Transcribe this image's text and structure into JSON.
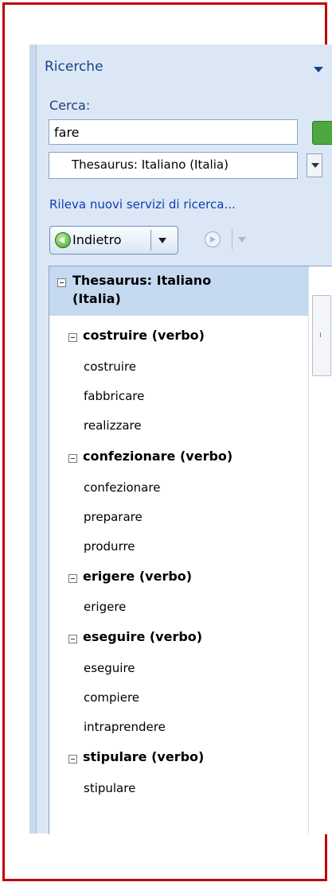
{
  "pane": {
    "title": "Ricerche"
  },
  "search": {
    "label": "Cerca:",
    "value": "fare"
  },
  "service": {
    "selected": "Thesaurus: Italiano (Italia)"
  },
  "links": {
    "more_services": "Rileva nuovi servizi di ricerca..."
  },
  "nav": {
    "back_label": "Indietro"
  },
  "results": {
    "root": {
      "label_line1": "Thesaurus: Italiano",
      "label_line2": "(Italia)"
    },
    "groups": [
      {
        "heading": "costruire (verbo)",
        "words": [
          "costruire",
          "fabbricare",
          "realizzare"
        ]
      },
      {
        "heading": "confezionare (verbo)",
        "words": [
          "confezionare",
          "preparare",
          "produrre"
        ]
      },
      {
        "heading": "erigere (verbo)",
        "words": [
          "erigere"
        ]
      },
      {
        "heading": "eseguire (verbo)",
        "words": [
          "eseguire",
          "compiere",
          "intraprendere"
        ]
      },
      {
        "heading": "stipulare (verbo)",
        "words": [
          "stipulare"
        ]
      }
    ]
  },
  "colors": {
    "frame": "#c00000",
    "pane": "#dce7f5",
    "title": "#15428b",
    "link": "#0d3db5",
    "selected_row": "#c5d9f1"
  }
}
